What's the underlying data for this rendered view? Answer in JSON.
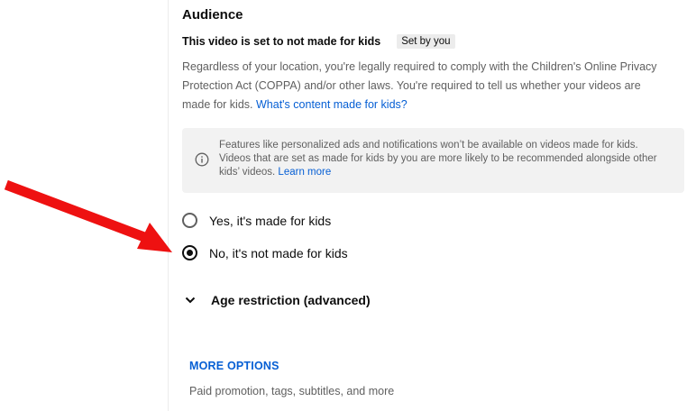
{
  "audience": {
    "title": "Audience",
    "status_text": "This video is set to not made for kids",
    "status_badge": "Set by you",
    "description": "Regardless of your location, you're legally required to comply with the Children's Online Privacy Protection Act (COPPA) and/or other laws. You're required to tell us whether your videos are made for kids.",
    "description_link": "What's content made for kids?",
    "info": {
      "icon": "info-icon",
      "text": "Features like personalized ads and notifications won’t be available on videos made for kids. Videos that are set as made for kids by you are more likely to be recommended alongside other kids’ videos.",
      "link": "Learn more"
    },
    "options": [
      {
        "label": "Yes, it's made for kids",
        "selected": false
      },
      {
        "label": "No, it's not made for kids",
        "selected": true
      }
    ]
  },
  "age_restriction": {
    "label": "Age restriction (advanced)",
    "icon": "chevron-down-icon"
  },
  "more_options": {
    "label": "MORE OPTIONS",
    "description": "Paid promotion, tags, subtitles, and more"
  },
  "annotation": {
    "arrow_color": "#ee1111"
  },
  "colors": {
    "link": "#065fd4",
    "primary_text": "#0d0d0d",
    "secondary_text": "#606060",
    "info_background": "#f2f2f2",
    "badge_background": "#ececec"
  }
}
